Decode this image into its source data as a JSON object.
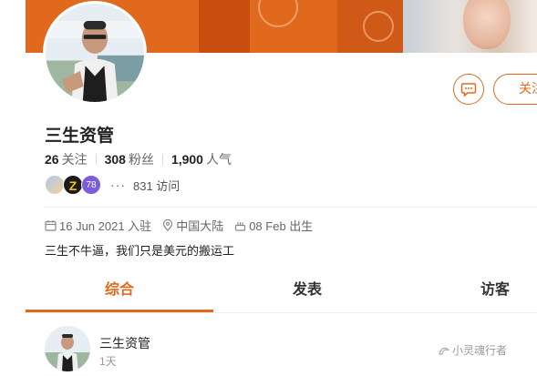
{
  "colors": {
    "accent": "#e0691e",
    "banner": "#e0691e",
    "level_badge": "#7c5cd8"
  },
  "header": {
    "message_icon": "chat-bubble-icon",
    "follow_label": "关注"
  },
  "profile": {
    "name": "三生资管",
    "stats": {
      "following_count": "26",
      "following_label": "关注",
      "fans_count": "308",
      "fans_label": "粉丝",
      "popularity_count": "1,900",
      "popularity_label": "人气"
    },
    "badges": {
      "z_badge": "Z",
      "level": "78"
    },
    "more": "···",
    "visits": "831 访问",
    "meta": {
      "joined": "16 Jun 2021 入驻",
      "location": "中国大陆",
      "birthday": "08 Feb 出生"
    },
    "bio": "三生不牛逼，我们只是美元的搬运工"
  },
  "tabs": [
    {
      "label": "综合",
      "active": true
    },
    {
      "label": "发表",
      "active": false
    },
    {
      "label": "访客",
      "active": false
    }
  ],
  "post": {
    "author": "三生资管",
    "time": "1天"
  },
  "watermark": "小灵魂行者"
}
